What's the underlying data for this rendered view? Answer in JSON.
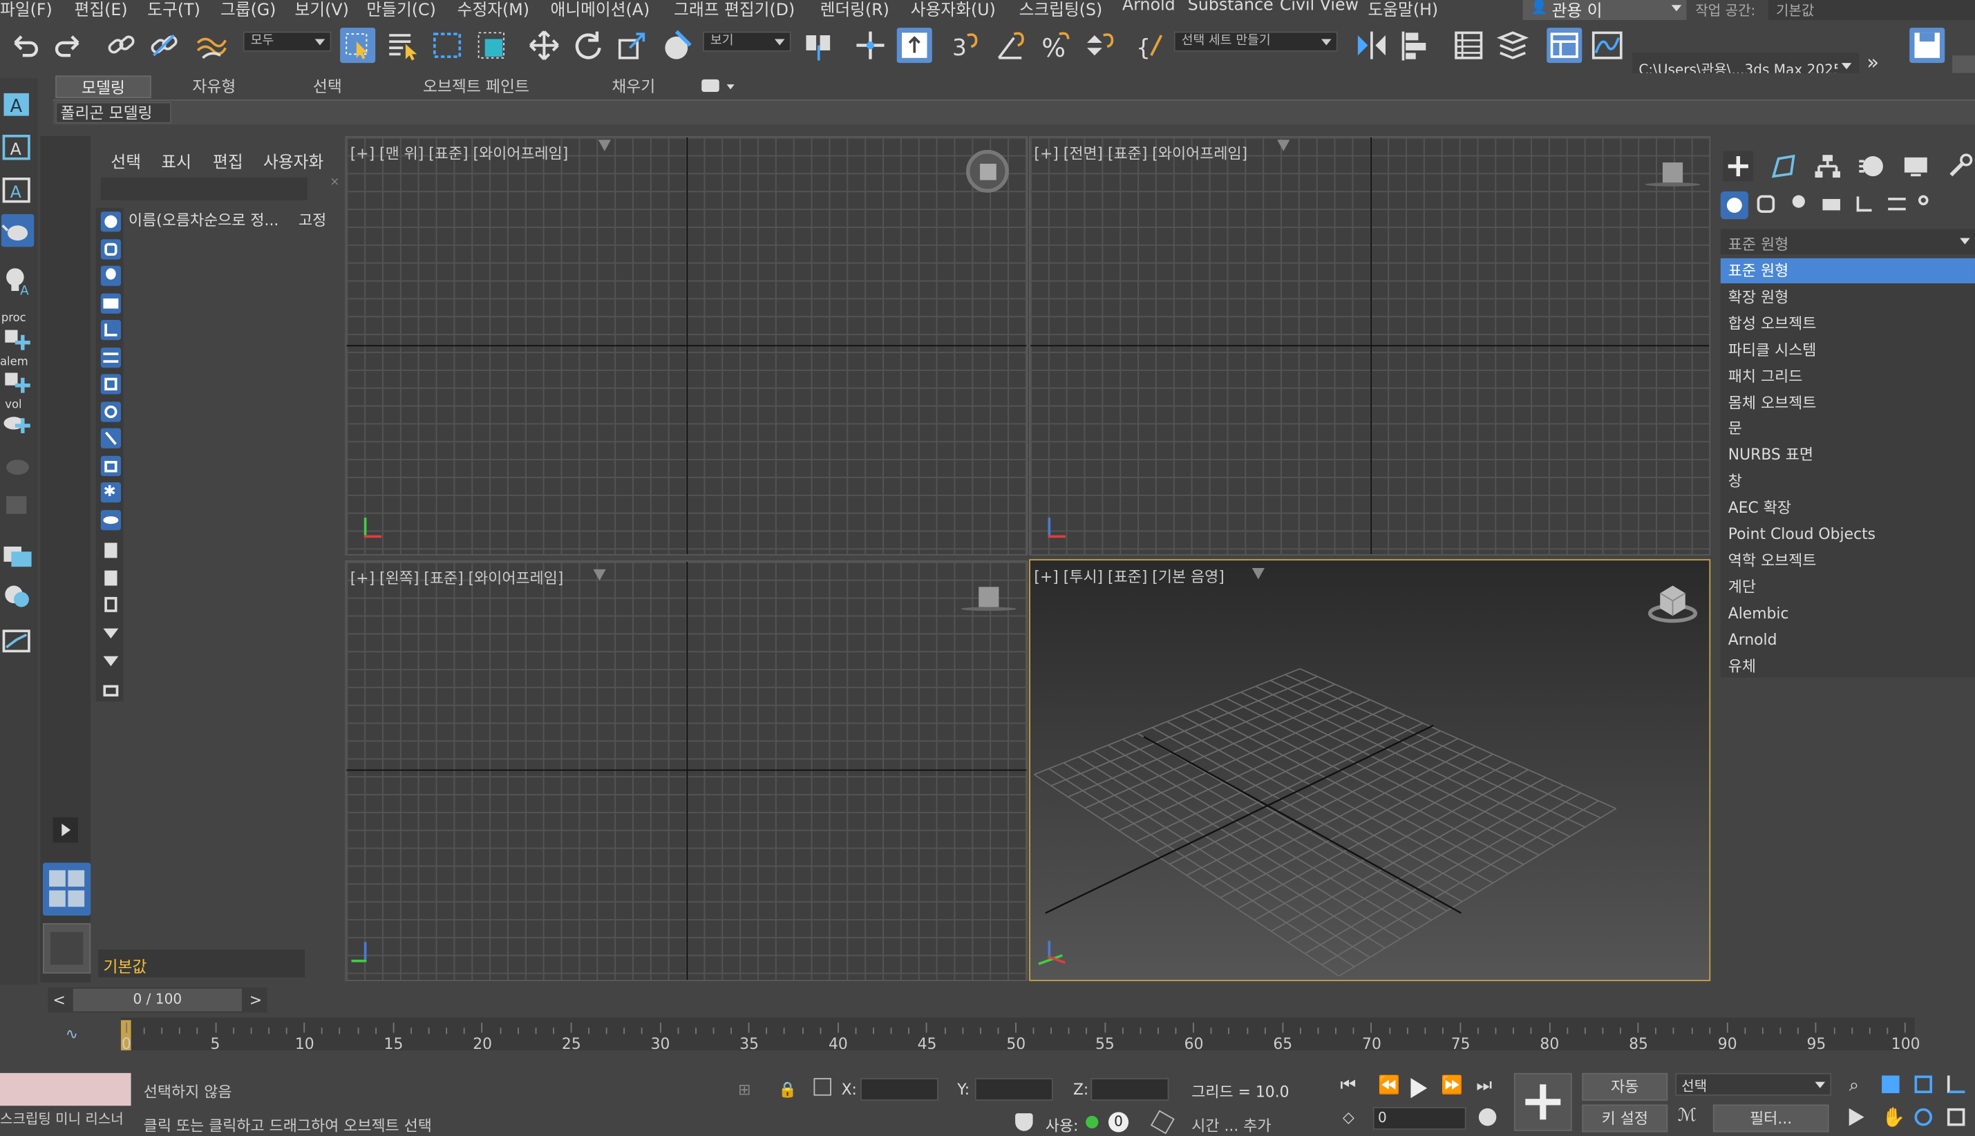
{
  "menu": [
    "파일(F)",
    "편집(E)",
    "도구(T)",
    "그룹(G)",
    "보기(V)",
    "만들기(C)",
    "수정자(M)",
    "애니메이션(A)",
    "그래프 편집기(D)",
    "렌더링(R)",
    "사용자화(U)",
    "스크립팅(S)",
    "Arnold",
    "Substance",
    "Civil View",
    "도움말(H)"
  ],
  "user": {
    "name": "관용 이",
    "workspace_label": "작업 공간:",
    "workspace_value": "기본값"
  },
  "toolbar": {
    "filter_dd": "모두",
    "view_dd": "보기",
    "selset_dd": "선택 세트 만들기",
    "path": "C:\\Users\\관용\\...3ds Max 2025"
  },
  "ribbon": {
    "tabs": [
      "모델링",
      "자유형",
      "선택",
      "오브젝트 페인트",
      "채우기"
    ],
    "sub": "폴리곤 모델링"
  },
  "scene_explorer": {
    "tabs": [
      "선택",
      "표시",
      "편집",
      "사용자화"
    ],
    "col_name": "이름(오름차순으로 정...",
    "col_lock": "고정",
    "layer": "기본값"
  },
  "left_strip": {
    "labels": [
      "proc",
      "alem",
      "vol"
    ]
  },
  "viewports": {
    "top": "[+] [맨 위] [표준] [와이어프레임]",
    "front": "[+] [전면] [표준] [와이어프레임]",
    "left": "[+] [왼쪽] [표준] [와이어프레임]",
    "persp": "[+] [투시] [표준] [기본 음영]"
  },
  "command_panel": {
    "dropdown": "표준 원형",
    "items": [
      "표준 원형",
      "확장 원형",
      "합성 오브젝트",
      "파티클 시스템",
      "패치 그리드",
      "몸체 오브젝트",
      "문",
      "NURBS 표면",
      "창",
      "AEC 확장",
      "Point Cloud Objects",
      "역학 오브젝트",
      "계단",
      "Alembic",
      "Arnold",
      "유체"
    ],
    "selected_index": 0
  },
  "timeline": {
    "counter": "0 / 100",
    "prev": "<",
    "next": ">",
    "ticks": [
      "0",
      "5",
      "10",
      "15",
      "20",
      "25",
      "30",
      "35",
      "40",
      "45",
      "50",
      "55",
      "60",
      "65",
      "70",
      "75",
      "80",
      "85",
      "90",
      "95",
      "100"
    ]
  },
  "status": {
    "selection": "선택하지 않음",
    "prompt": "클릭 또는 클릭하고 드래그하여 오브젝트 선택",
    "script_label": "스크립팅 미니 리스너",
    "x_label": "X:",
    "y_label": "Y:",
    "z_label": "Z:",
    "grid": "그리드 = 10.0",
    "use_label": "사용:",
    "use_count": "0",
    "time_add": "시간 ... 추가",
    "auto": "자동",
    "set_key": "키 설정",
    "sel_dd": "선택",
    "filter": "필터...",
    "frame": "0"
  },
  "colors": {
    "accent": "#4a86d6",
    "active_viewport": "#c8a248"
  }
}
